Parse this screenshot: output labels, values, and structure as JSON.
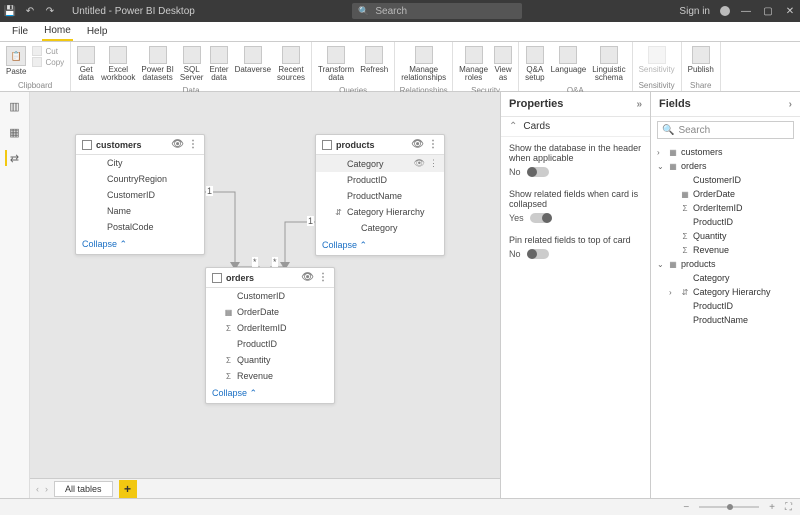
{
  "titlebar": {
    "title": "Untitled - Power BI Desktop",
    "search_placeholder": "Search",
    "signin": "Sign in"
  },
  "menu": {
    "file": "File",
    "home": "Home",
    "help": "Help"
  },
  "ribbon": {
    "cut": "Cut",
    "copy": "Copy",
    "get_data": "Get\ndata",
    "excel": "Excel\nworkbook",
    "pbi_ds": "Power BI\ndatasets",
    "sql": "SQL\nServer",
    "enter": "Enter\ndata",
    "dataverse": "Dataverse",
    "recent": "Recent\nsources",
    "transform": "Transform\ndata",
    "refresh": "Refresh",
    "manage_rel": "Manage\nrelationships",
    "manage_roles": "Manage\nroles",
    "view_as": "View\nas",
    "qna": "Q&A\nsetup",
    "language": "Language",
    "schema": "Linguistic\nschema",
    "sensitivity": "Sensitivity",
    "publish": "Publish",
    "grp_clipboard": "Clipboard",
    "grp_data": "Data",
    "grp_queries": "Queries",
    "grp_rel": "Relationships",
    "grp_sec": "Security",
    "grp_qna": "Q&A",
    "grp_sens": "Sensitivity",
    "grp_share": "Share"
  },
  "cards": {
    "customers": {
      "title": "customers",
      "fields": [
        "City",
        "CountryRegion",
        "CustomerID",
        "Name",
        "PostalCode"
      ],
      "collapse": "Collapse"
    },
    "products": {
      "title": "products",
      "fields": [
        {
          "label": "Category",
          "selected": true
        },
        {
          "label": "ProductID"
        },
        {
          "label": "ProductName"
        },
        {
          "label": "Category Hierarchy",
          "icon": "hier"
        },
        {
          "label": "Category",
          "sub": true
        }
      ],
      "collapse": "Collapse"
    },
    "orders": {
      "title": "orders",
      "fields": [
        {
          "label": "CustomerID"
        },
        {
          "label": "OrderDate",
          "icon": "date"
        },
        {
          "label": "OrderItemID",
          "icon": "sum"
        },
        {
          "label": "ProductID"
        },
        {
          "label": "Quantity",
          "icon": "sum"
        },
        {
          "label": "Revenue",
          "icon": "sum"
        }
      ],
      "collapse": "Collapse"
    }
  },
  "rel": {
    "one": "1",
    "many": "*"
  },
  "tabs": {
    "all": "All tables"
  },
  "properties": {
    "title": "Properties",
    "cards_section": "Cards",
    "prop1": "Show the database in the header when applicable",
    "prop1_state": "No",
    "prop2": "Show related fields when card is collapsed",
    "prop2_state": "Yes",
    "prop3": "Pin related fields to top of card",
    "prop3_state": "No"
  },
  "fields_panel": {
    "title": "Fields",
    "search_placeholder": "Search",
    "tree": {
      "customers": "customers",
      "orders": "orders",
      "orders_children": [
        {
          "label": "CustomerID"
        },
        {
          "label": "OrderDate",
          "icon": "date"
        },
        {
          "label": "OrderItemID",
          "icon": "sum"
        },
        {
          "label": "ProductID"
        },
        {
          "label": "Quantity",
          "icon": "sum"
        },
        {
          "label": "Revenue",
          "icon": "sum"
        }
      ],
      "products": "products",
      "products_children": [
        {
          "label": "Category"
        },
        {
          "label": "Category Hierarchy",
          "icon": "hier",
          "expandable": true
        },
        {
          "label": "ProductID"
        },
        {
          "label": "ProductName"
        }
      ]
    }
  },
  "icons": {
    "date": "▦",
    "sum": "Σ",
    "hier": "⇵",
    "search": "🔍",
    "chev_r": "›",
    "chev_d": "⌄",
    "chev_up": "⌃"
  }
}
